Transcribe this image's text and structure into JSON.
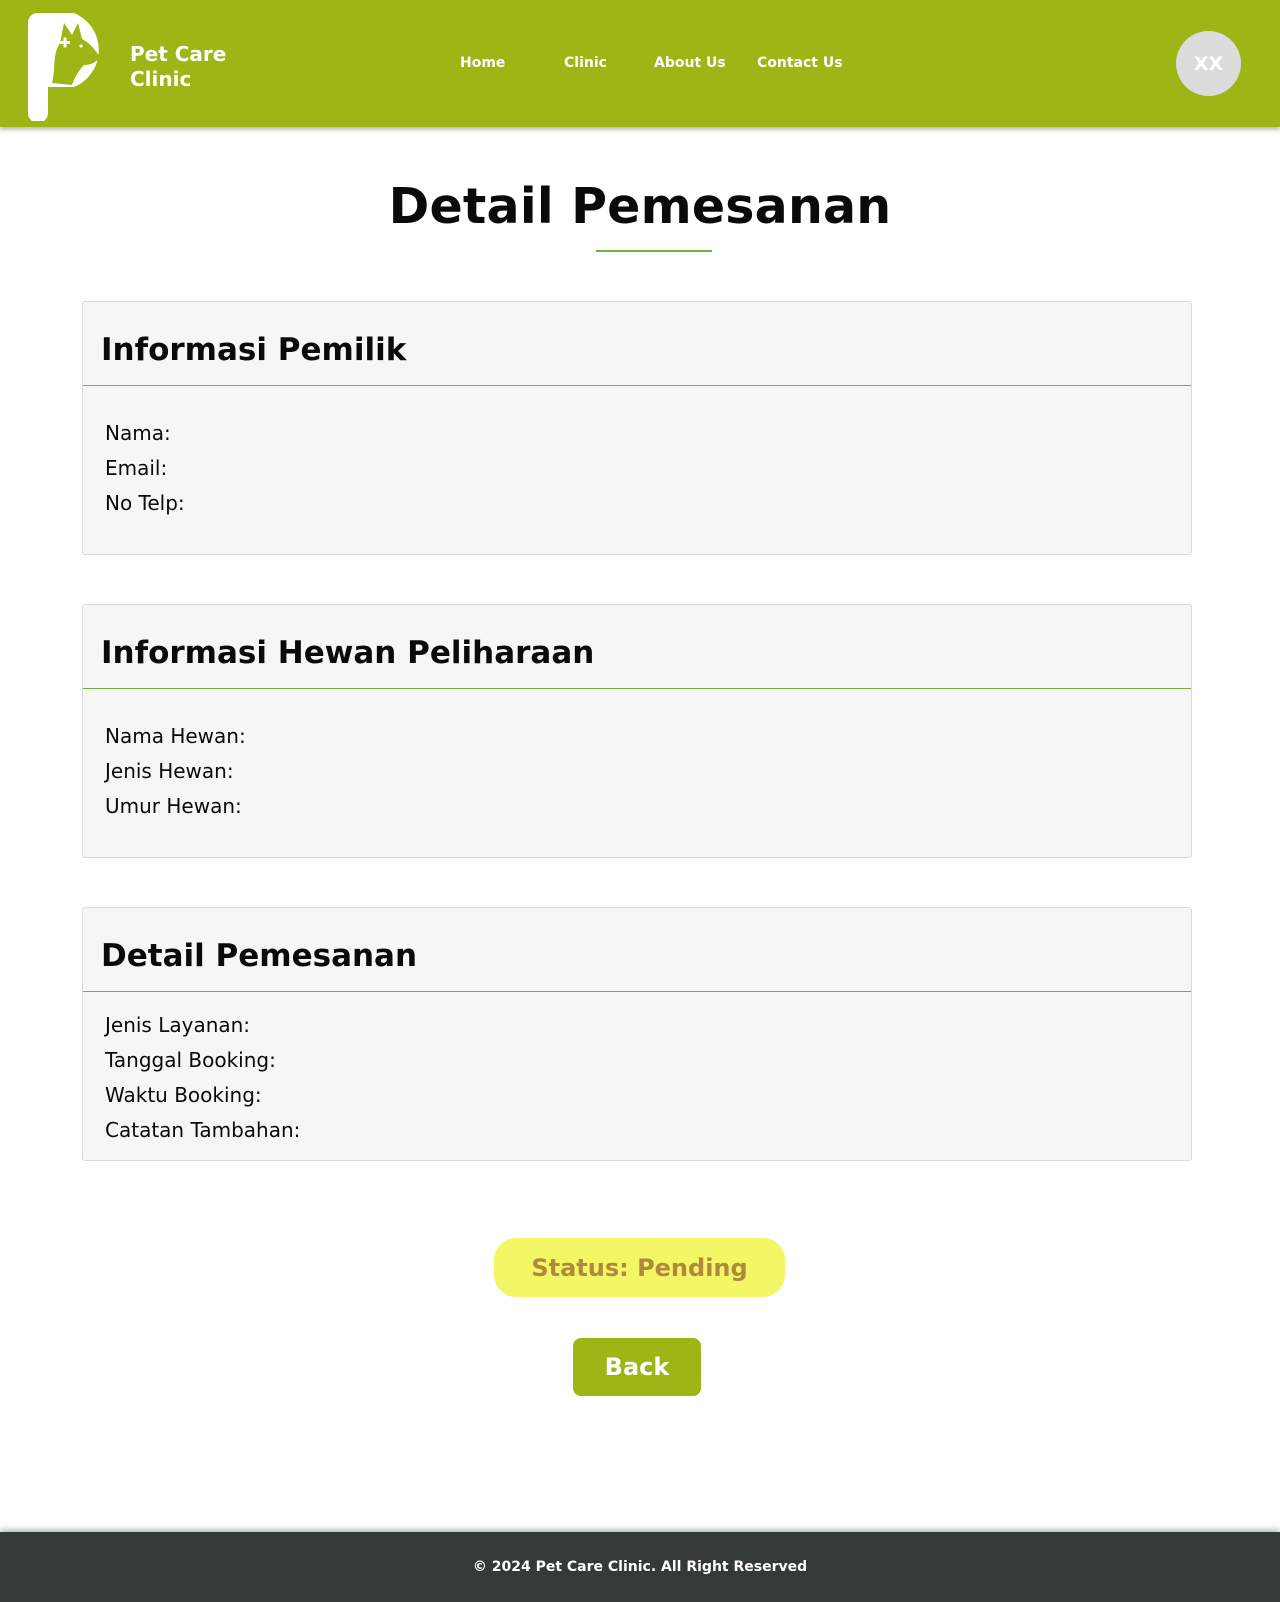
{
  "header": {
    "brand_name_line1": "Pet Care",
    "brand_name_line2": "Clinic",
    "nav": [
      {
        "label": "Home"
      },
      {
        "label": "Clinic"
      },
      {
        "label": "About Us"
      },
      {
        "label": "Contact Us"
      }
    ],
    "avatar_initials": "XX",
    "colors": {
      "navbar": "#9db515",
      "avatar": "#dcdcdc"
    }
  },
  "page": {
    "title": "Detail Pemesanan",
    "accent_color": "#6db33f"
  },
  "owner_info": {
    "title": "Informasi Pemilik",
    "fields": [
      {
        "label": "Nama:",
        "value": ""
      },
      {
        "label": "Email:",
        "value": ""
      },
      {
        "label": "No Telp:",
        "value": ""
      }
    ]
  },
  "pet_info": {
    "title": "Informasi Hewan Peliharaan",
    "fields": [
      {
        "label": "Nama Hewan:",
        "value": ""
      },
      {
        "label": "Jenis Hewan:",
        "value": ""
      },
      {
        "label": "Umur Hewan:",
        "value": ""
      }
    ]
  },
  "booking_detail": {
    "title": "Detail Pemesanan",
    "fields": [
      {
        "label": "Jenis Layanan:",
        "value": ""
      },
      {
        "label": "Tanggal Booking:",
        "value": ""
      },
      {
        "label": "Waktu Booking:",
        "value": ""
      },
      {
        "label": "Catatan Tambahan:",
        "value": ""
      }
    ]
  },
  "status": {
    "text": "Status: Pending",
    "colors": {
      "background": "#f3f766",
      "text": "#b08a3c"
    }
  },
  "actions": {
    "back_label": "Back"
  },
  "footer": {
    "text": "© 2024 Pet Care Clinic. All Right Reserved",
    "color": "#343a36"
  }
}
